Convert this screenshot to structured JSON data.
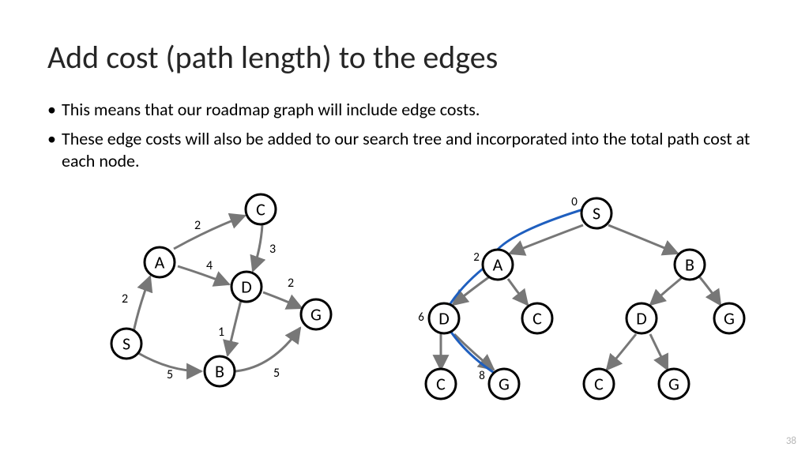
{
  "title": "Add cost (path length) to the edges",
  "bullets": [
    "This means that our roadmap graph will include edge costs.",
    "These edge costs will also be added to our search tree and incorporated into the total path cost at each node."
  ],
  "page_number": "38",
  "roadmap_graph": {
    "nodes": {
      "S": "S",
      "A": "A",
      "B": "B",
      "C": "C",
      "D": "D",
      "G": "G"
    },
    "edge_costs": {
      "SA": "2",
      "SB": "5",
      "AC": "2",
      "AD": "4",
      "CD": "3",
      "DB": "1",
      "DG": "2",
      "BG": "5"
    }
  },
  "search_tree": {
    "nodes": {
      "S": "S",
      "A": "A",
      "B": "B",
      "D1": "D",
      "C1": "C",
      "D2": "D",
      "G1": "G",
      "C2": "C",
      "G2": "G",
      "C3": "C",
      "G3": "G"
    },
    "totals": {
      "S": "0",
      "A": "2",
      "D1": "6",
      "G2": "8"
    }
  }
}
